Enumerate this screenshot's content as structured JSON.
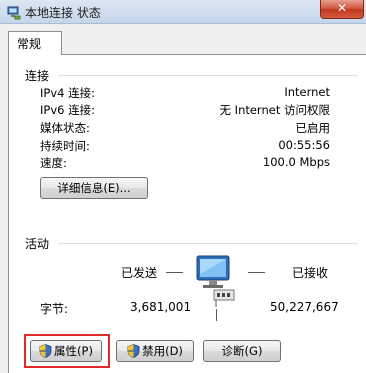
{
  "window": {
    "title": "本地连接 状态",
    "close_label": "✕"
  },
  "tabs": [
    {
      "label": "常规"
    }
  ],
  "connection": {
    "section_title": "连接",
    "rows": [
      {
        "label": "IPv4 连接:",
        "value": "Internet"
      },
      {
        "label": "IPv6 连接:",
        "value": "无 Internet 访问权限"
      },
      {
        "label": "媒体状态:",
        "value": "已启用"
      },
      {
        "label": "持续时间:",
        "value": "00:55:56"
      },
      {
        "label": "速度:",
        "value": "100.0 Mbps"
      }
    ],
    "details_button": "详细信息(E)..."
  },
  "activity": {
    "section_title": "活动",
    "sent_label": "已发送",
    "received_label": "已接收",
    "bytes_label": "字节:",
    "bytes_sent": "3,681,001",
    "bytes_received": "50,227,667"
  },
  "buttons": {
    "properties": "属性(P)",
    "disable": "禁用(D)",
    "diagnose": "诊断(G)"
  },
  "colors": {
    "highlight": "#e02a2a",
    "close_button": "#c0381f"
  },
  "icons": {
    "title": "network-adapter-icon",
    "activity": "network-computer-icon",
    "shield": "uac-shield-icon"
  }
}
